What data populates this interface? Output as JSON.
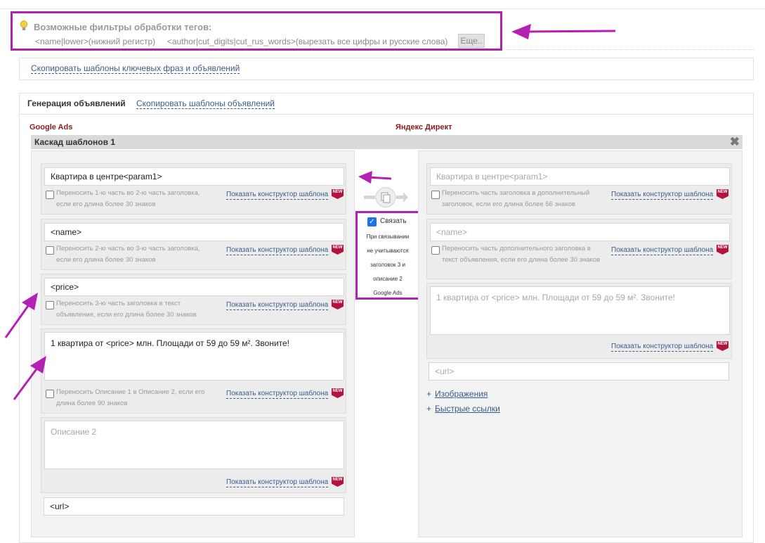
{
  "filters": {
    "title": "Возможные фильтры обработки тегов:",
    "ex1": "<name|lower>(нижний регистр)",
    "ex2": "<author|cut_digits|cut_rus_words>(вырезать все цифры и русские слова)",
    "more_label": "Еще.."
  },
  "copy_bar": {
    "link": "Скопировать шаблоны ключевых фраз и объявлений"
  },
  "generation": {
    "title": "Генерация объявлений",
    "copy_link": "Скопировать шаблоны объявлений"
  },
  "columns": {
    "google": "Google Ads",
    "yandex": "Яндекс Директ"
  },
  "cascade": {
    "title": "Каскад шаблонов 1"
  },
  "constructor_link": "Показать конструктор шаблона",
  "new_badge": "NEW",
  "google": {
    "headline1": {
      "value": "Квартира в центре<param1>",
      "option": "Переносить 1-ю часть во 2-ю часть заголовка, если его длина более 30 знаков"
    },
    "headline2": {
      "value": "<name>",
      "option": "Переносить 2-ю часть во 3-ю часть заголовка, если его длина более 30 знаков"
    },
    "headline3": {
      "value": "<price>",
      "option": "Переносить 3-ю часть заголовка в текст объявления, если его длина более 30 знаков"
    },
    "description1": {
      "value": "1 квартира от <price> млн. Площади от 59 до 59 м². Звоните!",
      "option": "Переносить Описание 1 в Описание 2, если его длина более 90 знаков"
    },
    "description2": {
      "placeholder": "Описание 2"
    },
    "url": {
      "value": "<url>"
    }
  },
  "sync": {
    "label": "Связать",
    "checked": true,
    "note_lines": [
      "При связывании",
      "не учитываются",
      "заголовок 3 и",
      "описание 2",
      "Google Ads"
    ]
  },
  "yandex": {
    "headline": {
      "placeholder": "Квартира в центре<param1>",
      "option": "Переносить часть заголовка в дополнительный заголовок, если его длина более 56 знаков"
    },
    "extra_headline": {
      "placeholder": "<name>",
      "option": "Переносить часть дополнительного заголовка в текст объявления, если его длина более 30 знаков"
    },
    "text": {
      "placeholder": "1 квартира от <price> млн. Площади от 59 до 59 м². Звоните!"
    },
    "url": {
      "placeholder": "<url>"
    },
    "images_link": "Изображения",
    "quick_links": "Быстрые ссылки"
  },
  "colors": {
    "annotation": "#b41fb4",
    "link": "#3a5c8a",
    "brand_heading": "#8a1c1c",
    "new_badge": "#b5133f"
  }
}
